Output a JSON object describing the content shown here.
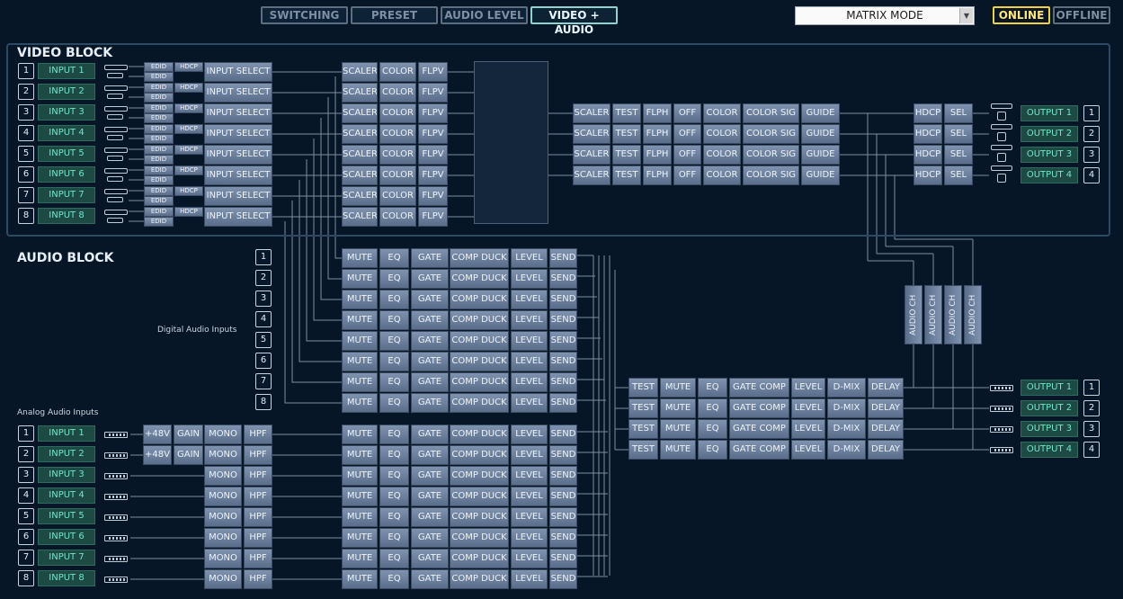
{
  "tabs": [
    "SWITCHING",
    "PRESET",
    "AUDIO LEVEL",
    "VIDEO + AUDIO"
  ],
  "active_tab": "VIDEO + AUDIO",
  "mode_select": {
    "value": "MATRIX MODE"
  },
  "status": {
    "online": "ONLINE",
    "offline": "OFFLINE"
  },
  "video_block": {
    "title": "VIDEO BLOCK",
    "inputs": [
      "INPUT 1",
      "INPUT 2",
      "INPUT 3",
      "INPUT 4",
      "INPUT 5",
      "INPUT 6",
      "INPUT 7",
      "INPUT 8"
    ],
    "input_numbers": [
      "1",
      "2",
      "3",
      "4",
      "5",
      "6",
      "7",
      "8"
    ],
    "edid": "EDID",
    "hdcp": "HDCP",
    "input_select": "INPUT SELECT",
    "input_chain": [
      "SCALER",
      "COLOR",
      "FLPV"
    ],
    "output_chain": [
      "SCALER",
      "TEST",
      "FLPH",
      "OFF",
      "COLOR",
      "COLOR SIG",
      "GUIDE"
    ],
    "output_hdcp": "HDCP",
    "output_sel": "SEL",
    "outputs": [
      "OUTPUT 1",
      "OUTPUT 2",
      "OUTPUT 3",
      "OUTPUT 4"
    ],
    "output_numbers": [
      "1",
      "2",
      "3",
      "4"
    ]
  },
  "audio_block": {
    "title": "AUDIO BLOCK",
    "digital_label": "Digital Audio Inputs",
    "analog_label": "Analog Audio Inputs",
    "digital_numbers": [
      "1",
      "2",
      "3",
      "4",
      "5",
      "6",
      "7",
      "8"
    ],
    "channel_chain": [
      "MUTE",
      "EQ",
      "GATE",
      "COMP DUCK",
      "LEVEL",
      "SEND"
    ],
    "analog_inputs": [
      "INPUT 1",
      "INPUT 2",
      "INPUT 3",
      "INPUT 4",
      "INPUT 5",
      "INPUT 6",
      "INPUT 7",
      "INPUT 8"
    ],
    "analog_numbers": [
      "1",
      "2",
      "3",
      "4",
      "5",
      "6",
      "7",
      "8"
    ],
    "phantom": "+48V",
    "gain": "GAIN",
    "mono": "MONO",
    "hpf": "HPF",
    "audio_ch": "AUDIO CH",
    "output_chain": [
      "TEST",
      "MUTE",
      "EQ",
      "GATE COMP",
      "LEVEL",
      "D-MIX",
      "DELAY"
    ],
    "outputs": [
      "OUTPUT 1",
      "OUTPUT 2",
      "OUTPUT 3",
      "OUTPUT 4"
    ],
    "output_numbers": [
      "1",
      "2",
      "3",
      "4"
    ]
  },
  "colors": {
    "background": "#071627",
    "button": "#6c81a0",
    "input_button": "#1d4a42",
    "accent_online": "#f0d23a",
    "route_line": "#f08a1e"
  }
}
